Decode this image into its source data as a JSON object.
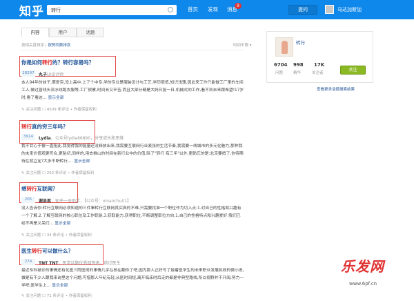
{
  "header": {
    "logo": "知乎",
    "search_value": "转行",
    "nav": [
      "首页",
      "发现",
      "消息"
    ],
    "message_badge": "9",
    "ask_button": "提问",
    "username": "马达加斯加"
  },
  "tabs": [
    {
      "label": "内容",
      "active": true
    },
    {
      "label": "用户",
      "active": false
    },
    {
      "label": "话题",
      "active": false
    }
  ],
  "filter": {
    "prefix": "按相关度排序",
    "separator": " | ",
    "link": "按赞同数排序"
  },
  "sort_label": "时间不限 ▾",
  "results": [
    {
      "title_pre": "你是如何",
      "title_hl": "转行",
      "title_post": "的？转行容易吗？",
      "votes": "28297",
      "author_name": "丸子",
      "author_desc": "UI设计师",
      "body": "本人94年的妹子,罪爱穷,没上高中,上了个中专,学的专业是服装设计与工艺,学历很低,知识浅薄,因此来工作只能做工厂里的车间工人,做过普线头流水线跑衣服等,工厂很累,时间长又辛苦,而且大部分都是大妈日复一日,机械式的工作,看不到未来跟希望!17岁时,看了看这…",
      "more": "显示全部",
      "meta": "✎ 关注问题   ☐ 4509 条评论   •   作者保留权利"
    },
    {
      "title_pre": "",
      "title_hl": "转行",
      "title_post": "真的穷三年吗？",
      "votes": "3914",
      "author_name": "Lydia",
      "author_desc": "，公众号lydia66890，分享成长和思维",
      "body": "我不甘心于被一直阻此,我觉得我的能量还没释放出来,我需要互联网行业紧张的生活节奏,我需要一线城市的多元化魅力,那种我的未来价值观更符合,更贴切,同样的,用去推山的时间在新行业中的价值,除了\"转行 有三年\"以外,更助忘的是:北京要捎了,你待期待在就立定?大多不断转行,…",
      "more": "显示全部",
      "meta": "✎ 关注问题   ☐ 252 条评论   •   作者保留权利"
    },
    {
      "title_pre": "想",
      "title_hl": "转行",
      "title_post": "互联网？",
      "votes": "205",
      "author_name": "谢呆君",
      "author_desc": "，知乎一员助手，【公众号：xinanchu01】",
      "body": "没人告诉你:转行互联网必须知道的三件事转行互联网其实真的不难,只需要找准一个职位作为切入点:1.对自己的性格和兴趣有一个了解.2.了解互联网的核心职位及工作职能.3.获取能力,获得职位,不断调整职位方向.1.自己的性格特点和兴趣爱好:我们已经不再是义呆们…",
      "more": "显示全部",
      "meta": "✎ 关注问题   ☐ 34 条评论   •   作者保留权利"
    },
    {
      "title_pre": "医生",
      "title_hl": "转行",
      "title_post": "可以做什么？",
      "votes": "274",
      "author_name": "TNT TNT",
      "author_desc": "，医学话题优秀回答者，前过医生",
      "body": "最近专科被诊的事情还有化医三院医闹的事情几乎在核在翻你了吧,因为那人正好写了接着医学生的未来职业发展执政的微小说,做是有不少人跟我来询里这个问题,可惜那人年纪有轻,从医时间短,离开临床时后走的都是非典型路线,所以视野并不开阔,努力一学吧,医学生上…",
      "more": "显示全部",
      "meta": "✎ 关注问题   ☐ 71 条评论   •   作者保留权利"
    }
  ],
  "topic_card": {
    "name": "转行",
    "stats": [
      {
        "value": "6704",
        "label": "问题"
      },
      {
        "value": "998",
        "label": "精华"
      },
      {
        "value": "17K",
        "label": "关注者"
      }
    ],
    "follow_button": "关注",
    "more_link": "查看更多话题搜索结果"
  },
  "watermark": {
    "brand": "乐发网",
    "url": "www.6pf.cn"
  },
  "colors": {
    "topbar": "#0f88eb",
    "highlight": "#d22222",
    "link": "#225599",
    "box": "#e34b4b",
    "follow": "#8ab923"
  }
}
